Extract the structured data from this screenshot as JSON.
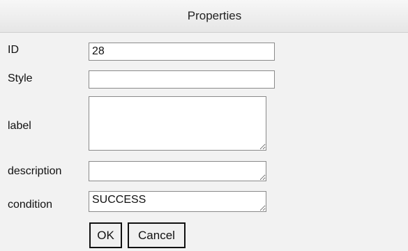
{
  "dialog": {
    "title": "Properties"
  },
  "form": {
    "id": {
      "label": "ID",
      "value": "28"
    },
    "style": {
      "label": "Style",
      "value": ""
    },
    "label": {
      "label": "label",
      "value": ""
    },
    "description": {
      "label": "description",
      "value": ""
    },
    "condition": {
      "label": "condition",
      "value": "SUCCESS"
    }
  },
  "buttons": {
    "ok": "OK",
    "cancel": "Cancel"
  }
}
